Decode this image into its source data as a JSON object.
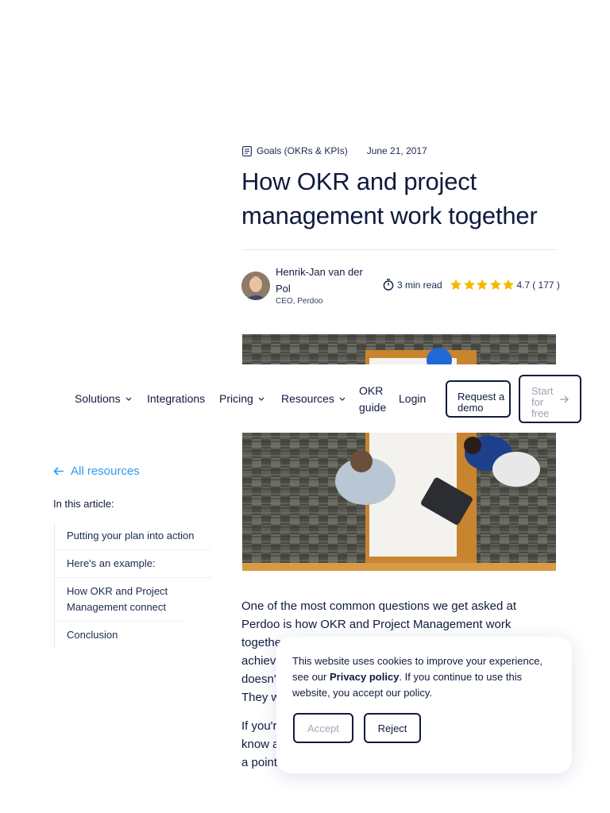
{
  "article": {
    "category": "Goals (OKRs & KPIs)",
    "date": "June 21, 2017",
    "title": "How OKR and project management work together",
    "author_name": "Henrik-Jan van der Pol",
    "author_role": "CEO, Perdoo",
    "read_time": "3 min read",
    "rating_score": "4.7",
    "rating_count": "( 177 )",
    "rating_stars": 5,
    "body_line1": "One of the most common questions we get asked at Perdoo is how OKR and Project Management work",
    "body_line2_visible": "togethe",
    "body_line3_visible": "achiev",
    "body_line4_visible": "doesn'",
    "body_line5_visible": "They w",
    "body_para2_line1": "If you'r",
    "body_para2_line2": "know a",
    "body_para2_line3": "a point"
  },
  "nav": {
    "solutions": "Solutions",
    "integrations": "Integrations",
    "pricing": "Pricing",
    "resources": "Resources",
    "okr_guide": "OKR guide",
    "login": "Login",
    "request_demo": "Request a demo",
    "start_free": "Start for free"
  },
  "sidebar": {
    "back_label": "All resources",
    "toc_heading": "In this article:",
    "toc_items": [
      "Putting your plan into action",
      "Here's an example:",
      "How OKR and Project Management connect",
      "Conclusion"
    ]
  },
  "cookie": {
    "text_before": "This website uses cookies to improve your experience, see our ",
    "link": "Privacy policy",
    "text_after": ". If you continue to use this website, you accept our policy.",
    "accept": "Accept",
    "reject": "Reject"
  },
  "colors": {
    "navy": "#0f1b3d",
    "link_blue": "#2e9bf0",
    "star_yellow": "#f5b800",
    "muted": "#9aa1b3"
  }
}
